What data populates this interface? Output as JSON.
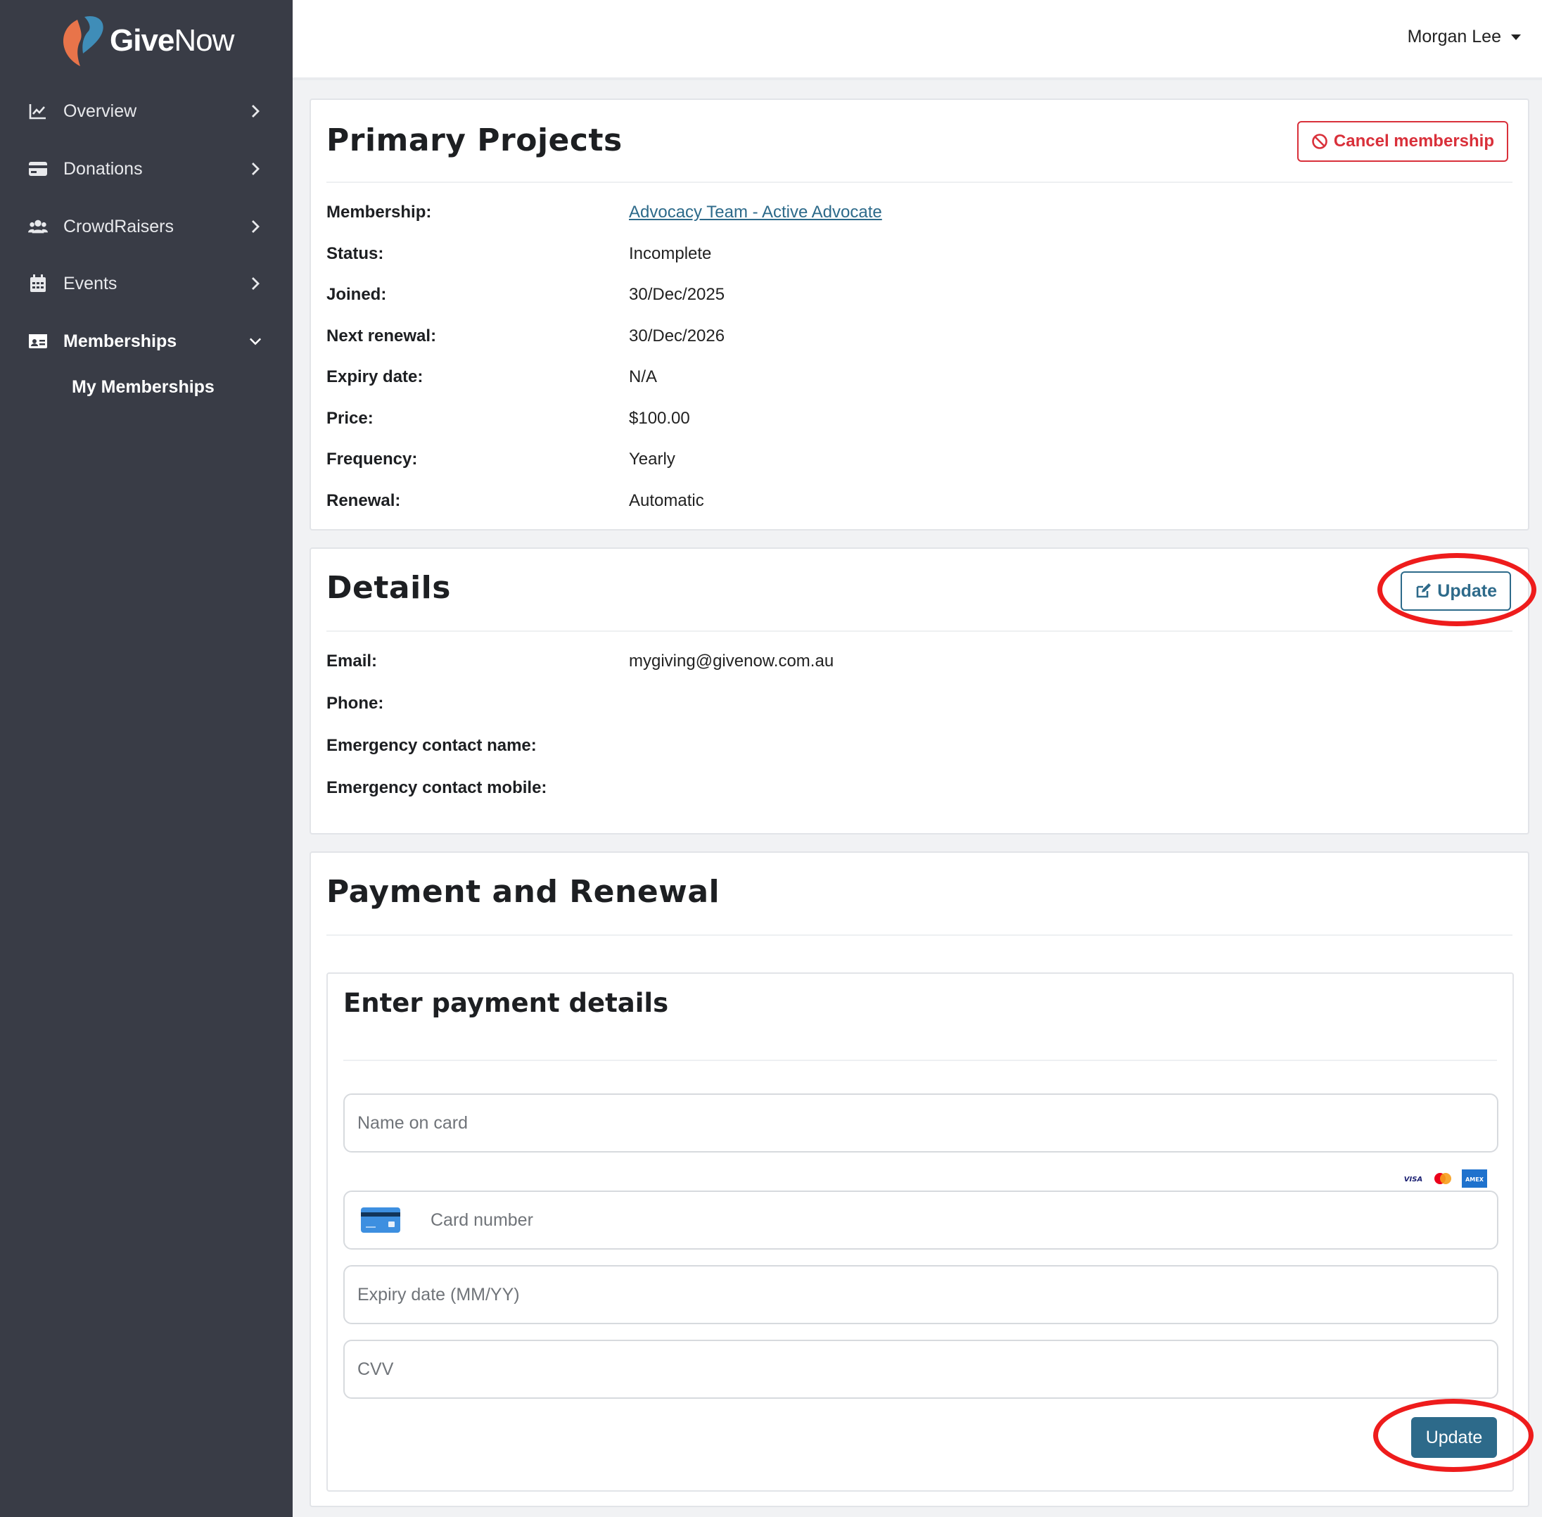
{
  "brand": {
    "name_bold": "Give",
    "name_light": "Now"
  },
  "user": {
    "name": "Morgan Lee"
  },
  "sidebar": {
    "items": [
      {
        "label": "Overview",
        "icon": "chart-line-icon"
      },
      {
        "label": "Donations",
        "icon": "credit-card-icon"
      },
      {
        "label": "CrowdRaisers",
        "icon": "users-icon"
      },
      {
        "label": "Events",
        "icon": "calendar-icon"
      },
      {
        "label": "Memberships",
        "icon": "id-card-icon",
        "active": true
      }
    ],
    "sub_items": [
      {
        "label": "My Memberships"
      }
    ]
  },
  "primary": {
    "title": "Primary Projects",
    "cancel_label": "Cancel membership",
    "rows": [
      {
        "label": "Membership:",
        "value": "Advocacy Team - Active Advocate"
      },
      {
        "label": "Status:",
        "value": "Incomplete"
      },
      {
        "label": "Joined:",
        "value": "30/Dec/2025"
      },
      {
        "label": "Next renewal:",
        "value": "30/Dec/2026"
      },
      {
        "label": "Expiry date:",
        "value": "N/A"
      },
      {
        "label": "Price:",
        "value": "$100.00"
      },
      {
        "label": "Frequency:",
        "value": "Yearly"
      },
      {
        "label": "Renewal:",
        "value": "Automatic"
      }
    ]
  },
  "details": {
    "title": "Details",
    "update_label": "Update",
    "rows": [
      {
        "label": "Email:",
        "value": "mygiving@givenow.com.au"
      },
      {
        "label": "Phone:",
        "value": ""
      },
      {
        "label": "Emergency contact name:",
        "value": ""
      },
      {
        "label": "Emergency contact mobile:",
        "value": ""
      }
    ]
  },
  "payment": {
    "title": "Payment and Renewal",
    "form_title": "Enter payment details",
    "fields": {
      "name_placeholder": "Name on card",
      "card_placeholder": "Card number",
      "expiry_placeholder": "Expiry date (MM/YY)",
      "cvv_placeholder": "CVV"
    },
    "card_brands": [
      "VISA",
      "mastercard",
      "AMEX"
    ],
    "update_label": "Update"
  },
  "colors": {
    "sidebar_bg": "#393c46",
    "accent": "#2d6a8a",
    "danger": "#d9303a",
    "annotation": "#ee1c1c"
  }
}
